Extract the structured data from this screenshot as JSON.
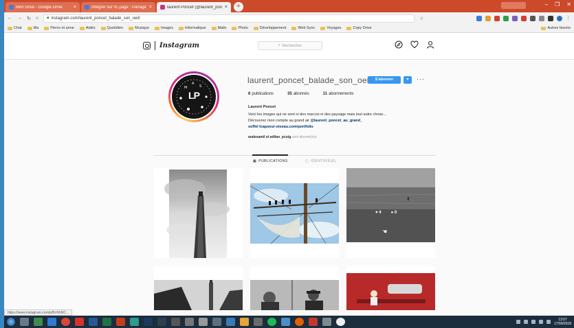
{
  "browser": {
    "tabs": [
      {
        "title": "Mon Drive - Google Drive",
        "active": false
      },
      {
        "title": "Intégrer sur l'E.page : Partagé",
        "active": false
      },
      {
        "title": "laurent Poncet (@laurent_pon...",
        "active": true
      }
    ],
    "url": "instagram.com/laurent_poncet_balade_son_oeil/",
    "bookmarks": [
      "Chat",
      "Ma",
      "Pierre et anne",
      "Aidés",
      "Quotidien",
      "Musique",
      "Images",
      "Informatique",
      "Mails",
      "Photo",
      "Développement",
      "Web Sync",
      "Voyages",
      "Copy Drive"
    ],
    "bookmarks_right": "Autres favoris",
    "status_url": "https://www.instagram.com/p/BrXthNC..."
  },
  "instagram": {
    "wordmark": "Instagram",
    "search_placeholder": "Rechercher",
    "profile": {
      "avatar_initials": "LP",
      "username": "laurent_poncet_balade_son_oeil",
      "follow_label": "S'abonner",
      "dropdown_label": "▾",
      "more_label": "···",
      "stats": {
        "posts_count": "6",
        "posts_label": "publications",
        "followers_count": "35",
        "followers_label": "abonnés",
        "following_count": "11",
        "following_label": "abonnements"
      },
      "full_name": "Laurent Poncet",
      "bio_line1": "Voici les images qui ne sont ni des marcos ni des paysage mais tout autre chose...",
      "bio_line2_prefix": "Découvrez mon compte au grand air ",
      "bio_line2_link": "@laurent_poncet_au_grand_",
      "bio_line3_prefix": "",
      "bio_line3_link": "soffel lcapseur-oiseau.com/portfolio",
      "followed_by_prefix": "",
      "followed_by_names": "aralesamil et adilan_pcstg",
      "followed_by_suffix": "sont abonné(e)s"
    },
    "tabs": [
      {
        "label": "PUBLICATIONS",
        "active": true
      },
      {
        "label": "IDENTIFIÉ(E)",
        "active": false
      }
    ],
    "hover_overlay": {
      "likes": "4",
      "comments": "0"
    }
  },
  "taskbar": {
    "time": "13:57",
    "date": "17/09/2018"
  },
  "colors": {
    "follow_blue": "#3897f0",
    "chrome_accent": "#cc4a2a",
    "taskbar": "#1c2d3e"
  }
}
